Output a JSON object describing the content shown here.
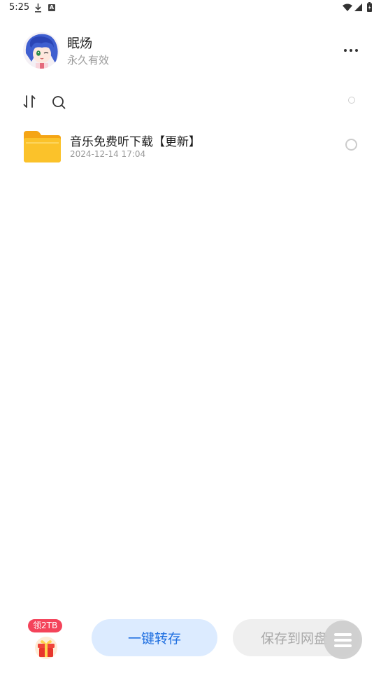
{
  "status_bar": {
    "time": "5:25",
    "icons": [
      "download-icon",
      "a-icon",
      "wifi-icon",
      "signal-icon",
      "battery-icon"
    ]
  },
  "header": {
    "user_name": "眠炀",
    "user_status": "永久有效",
    "avatar_icon": "anime-avatar"
  },
  "toolbar": {
    "icons": [
      "sort-icon",
      "search-icon"
    ]
  },
  "files": [
    {
      "name": "音乐免费听下载【更新】",
      "date": "2024-12-14 17:04",
      "icon": "folder-icon"
    }
  ],
  "bottom_bar": {
    "gift_badge": "领2TB",
    "transfer_label": "一键转存",
    "save_label": "保存到网盘"
  },
  "colors": {
    "primary": "#1f6fe0",
    "primary_light": "#dcebff",
    "badge": "#f4435a",
    "folder": "#f9b716",
    "muted_text": "#9a9a9a"
  }
}
